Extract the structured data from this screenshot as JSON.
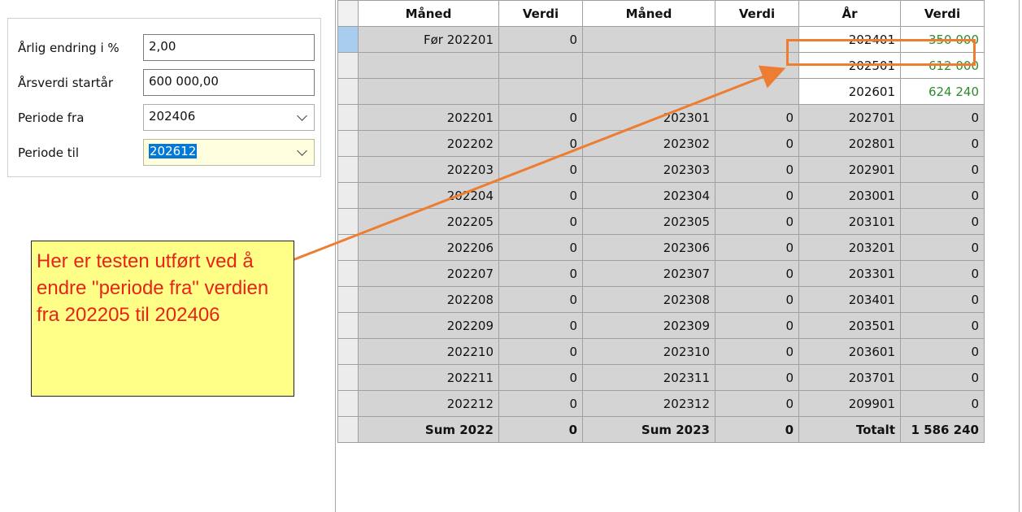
{
  "form": {
    "fields": [
      {
        "label": "Årlig endring i %",
        "value": "2,00",
        "type": "input"
      },
      {
        "label": "Årsverdi startår",
        "value": "600 000,00",
        "type": "input"
      },
      {
        "label": "Periode fra",
        "value": "202406",
        "type": "select"
      },
      {
        "label": "Periode til",
        "value": "202612",
        "type": "select",
        "active": true
      }
    ]
  },
  "grid": {
    "headers": [
      "Måned",
      "Verdi",
      "Måned",
      "Verdi",
      "År",
      "Verdi"
    ],
    "rows": [
      [
        "Før 202201",
        "0",
        "",
        "",
        "202401",
        "350 000"
      ],
      [
        "",
        "",
        "",
        "",
        "202501",
        "612 000"
      ],
      [
        "",
        "",
        "",
        "",
        "202601",
        "624 240"
      ],
      [
        "202201",
        "0",
        "202301",
        "0",
        "202701",
        "0"
      ],
      [
        "202202",
        "0",
        "202302",
        "0",
        "202801",
        "0"
      ],
      [
        "202203",
        "0",
        "202303",
        "0",
        "202901",
        "0"
      ],
      [
        "202204",
        "0",
        "202304",
        "0",
        "203001",
        "0"
      ],
      [
        "202205",
        "0",
        "202305",
        "0",
        "203101",
        "0"
      ],
      [
        "202206",
        "0",
        "202306",
        "0",
        "203201",
        "0"
      ],
      [
        "202207",
        "0",
        "202307",
        "0",
        "203301",
        "0"
      ],
      [
        "202208",
        "0",
        "202308",
        "0",
        "203401",
        "0"
      ],
      [
        "202209",
        "0",
        "202309",
        "0",
        "203501",
        "0"
      ],
      [
        "202210",
        "0",
        "202310",
        "0",
        "203601",
        "0"
      ],
      [
        "202211",
        "0",
        "202311",
        "0",
        "203701",
        "0"
      ],
      [
        "202212",
        "0",
        "202312",
        "0",
        "209901",
        "0"
      ]
    ],
    "sum_row": [
      "Sum 2022",
      "0",
      "Sum 2023",
      "0",
      "Totalt",
      "1 586 240"
    ]
  },
  "annotation": {
    "text": "Her er testen utført ved å endre \"periode fra\" verdien fra 202205 til 202406",
    "text_color": "#e8231a",
    "background": "#ffff88",
    "arrow_color": "#ed7d31"
  },
  "colors": {
    "positive_value": "#2e8b2e",
    "cell_gray": "#d4d4d4",
    "selection": "#0078d7"
  }
}
